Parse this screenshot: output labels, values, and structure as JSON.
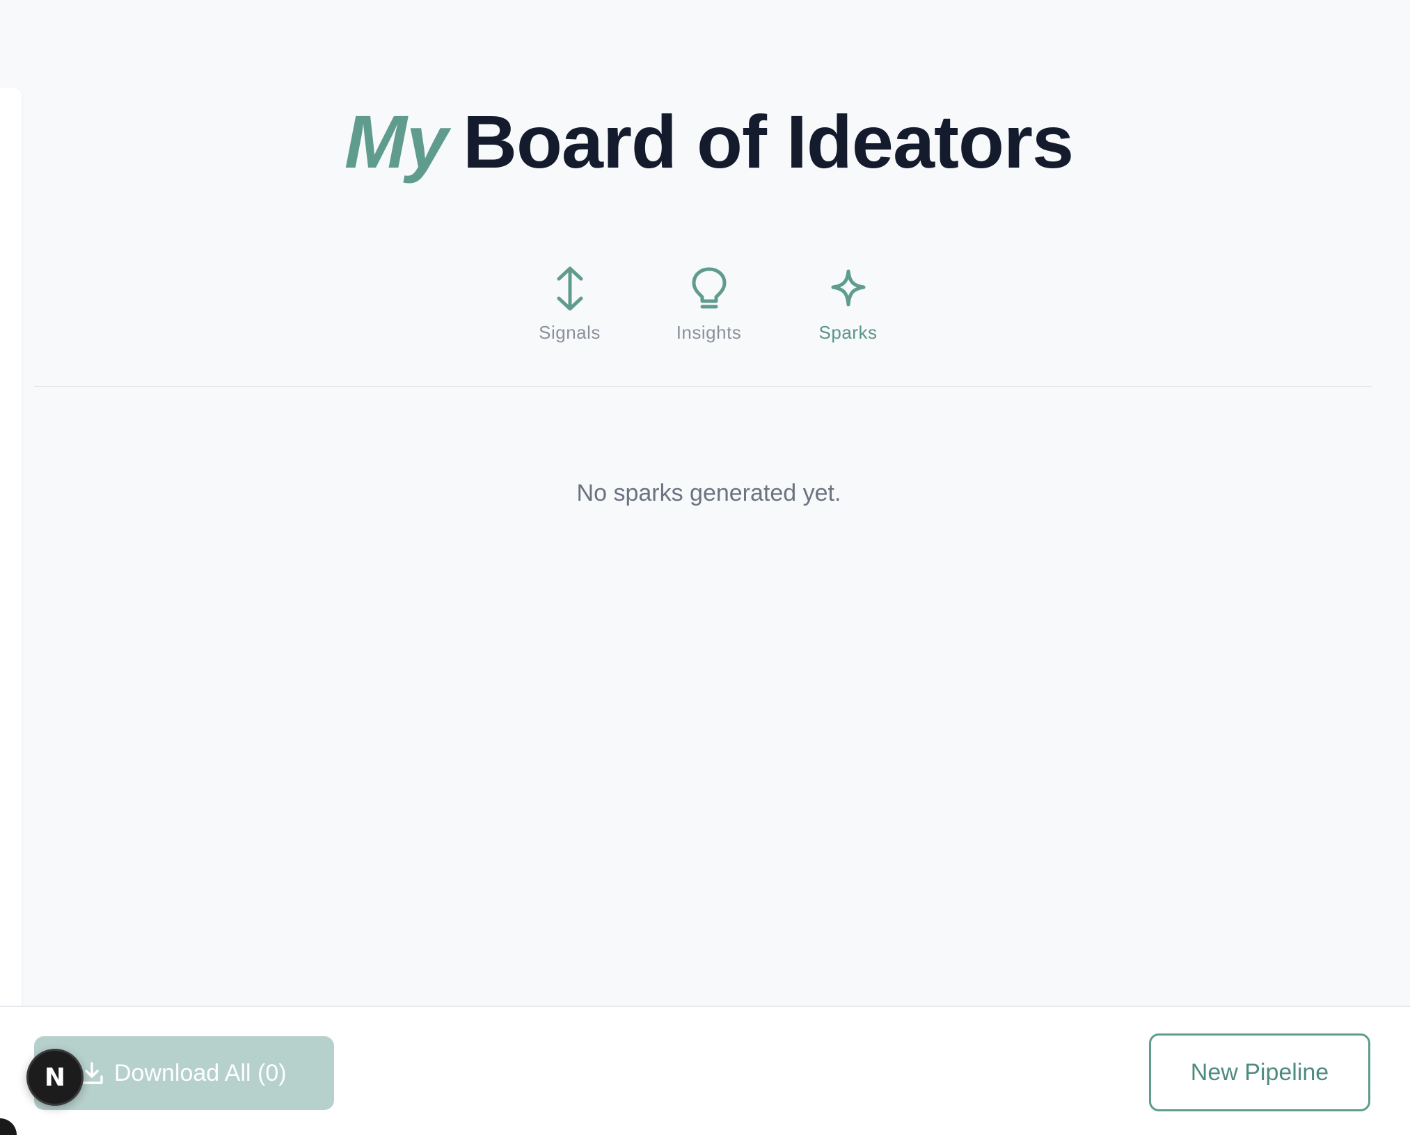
{
  "header": {
    "title_accent": "My",
    "title_main": "Board of Ideators"
  },
  "tabs": [
    {
      "label": "Signals",
      "icon": "vertical-arrows-icon",
      "active": false
    },
    {
      "label": "Insights",
      "icon": "lightbulb-icon",
      "active": false
    },
    {
      "label": "Sparks",
      "icon": "sparkle-icon",
      "active": true
    }
  ],
  "content": {
    "empty_message": "No sparks generated yet."
  },
  "footer": {
    "download_label": "Download All (0)",
    "new_pipeline_label": "New Pipeline"
  },
  "badge": {
    "letter": "N"
  },
  "colors": {
    "accent": "#5f9c8e",
    "title": "#141b2d",
    "download_bg": "#b6d0cc"
  }
}
